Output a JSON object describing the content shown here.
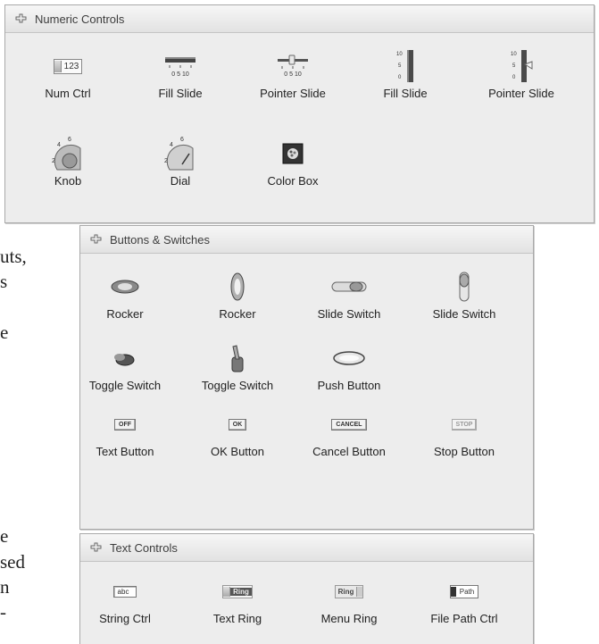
{
  "background_text": [
    "uts,",
    "s",
    "e",
    "e",
    "sed",
    "n",
    "-"
  ],
  "numeric_controls": {
    "title": "Numeric Controls",
    "items": [
      {
        "label": "Num Ctrl",
        "icon": "num-ctrl-icon",
        "text": "123"
      },
      {
        "label": "Fill Slide",
        "icon": "horizontal-fill-slide-icon",
        "ticks": "0 5 10"
      },
      {
        "label": "Pointer Slide",
        "icon": "horizontal-pointer-slide-icon",
        "ticks": "0 5 10"
      },
      {
        "label": "Fill Slide",
        "icon": "vertical-fill-slide-icon",
        "ticks": "10 5 0"
      },
      {
        "label": "Pointer Slide",
        "icon": "vertical-pointer-slide-icon",
        "ticks": "10 5 0"
      },
      {
        "label": "Knob",
        "icon": "knob-icon",
        "ticks": "2 4 6"
      },
      {
        "label": "Dial",
        "icon": "dial-icon",
        "ticks": "2 4 6"
      },
      {
        "label": "Color Box",
        "icon": "color-box-icon"
      }
    ]
  },
  "buttons_switches": {
    "title": "Buttons & Switches",
    "items": [
      {
        "label": "Rocker",
        "icon": "horizontal-rocker-icon"
      },
      {
        "label": "Rocker",
        "icon": "vertical-rocker-icon"
      },
      {
        "label": "Slide Switch",
        "icon": "horizontal-slide-switch-icon"
      },
      {
        "label": "Slide Switch",
        "icon": "vertical-slide-switch-icon"
      },
      {
        "label": "Toggle Switch",
        "icon": "toggle-switch-icon"
      },
      {
        "label": "Toggle Switch",
        "icon": "toggle-switch-lever-icon"
      },
      {
        "label": "Push Button",
        "icon": "push-button-icon"
      },
      {
        "label": "Text Button",
        "icon": "text-button-icon",
        "btn_text": "OFF"
      },
      {
        "label": "OK Button",
        "icon": "ok-button-icon",
        "btn_text": "OK"
      },
      {
        "label": "Cancel Button",
        "icon": "cancel-button-icon",
        "btn_text": "CANCEL"
      },
      {
        "label": "Stop Button",
        "icon": "stop-button-icon",
        "btn_text": "STOP"
      }
    ]
  },
  "text_controls": {
    "title": "Text Controls",
    "items": [
      {
        "label": "String Ctrl",
        "icon": "string-ctrl-icon",
        "text": "abc"
      },
      {
        "label": "Text Ring",
        "icon": "text-ring-icon",
        "text": "Ring"
      },
      {
        "label": "Menu Ring",
        "icon": "menu-ring-icon",
        "text": "Ring"
      },
      {
        "label": "File Path Ctrl",
        "icon": "file-path-ctrl-icon",
        "text": "Path"
      }
    ]
  }
}
